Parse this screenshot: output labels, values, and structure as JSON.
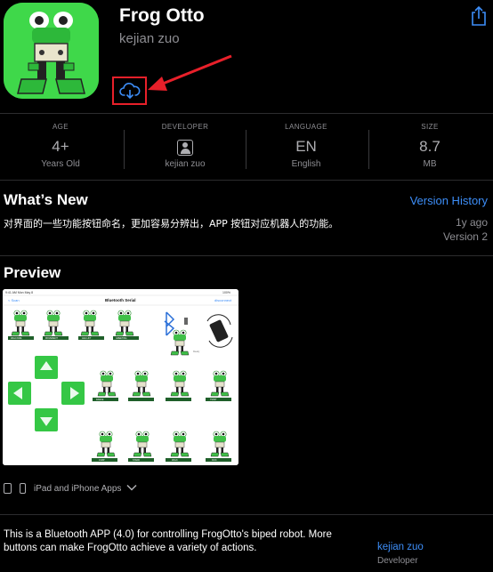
{
  "app": {
    "title": "Frog Otto",
    "developer": "kejian zuo"
  },
  "icons": {
    "share": "share-icon",
    "download": "cloud-download-icon",
    "developer": "person-square-icon"
  },
  "colors": {
    "accent": "#3d8ef8",
    "highlight": "#e8202a",
    "icon_bg": "#3fd84a"
  },
  "info": [
    {
      "caption": "AGE",
      "main": "4+",
      "sub": "Years Old"
    },
    {
      "caption": "DEVELOPER",
      "main": "",
      "sub": "kejian zuo"
    },
    {
      "caption": "LANGUAGE",
      "main": "EN",
      "sub": "English"
    },
    {
      "caption": "SIZE",
      "main": "8.7",
      "sub": "MB"
    }
  ],
  "whats_new": {
    "title": "What’s New",
    "version_history": "Version History",
    "text": "对界面的一些功能按钮命名，更加容易分辨出，APP 按钮对应机器人的功能。",
    "age": "1y ago",
    "version": "Version 2"
  },
  "preview": {
    "title": "Preview",
    "shot": {
      "status_left": "9:41 AM  Mon May 8",
      "status_right": "100%",
      "header_title": "Bluetooth Serial",
      "back": "< Scan",
      "disconnect": "disconnect",
      "frog_labels_top": [
        "WELCOME",
        "MOVEMENT",
        "LEG LIFT",
        "GREETING"
      ],
      "frog_labels_mid": [
        "DANCE",
        "",
        "",
        "TWIST"
      ],
      "frog_labels_bottom": [
        "JUMP",
        "STAND",
        "WALK",
        "KICK"
      ],
      "small_label": "Ready"
    }
  },
  "devices": {
    "label": "iPad and iPhone Apps"
  },
  "description": {
    "text": "This is a Bluetooth APP (4.0) for controlling FrogOtto's biped robot. More buttons can make FrogOtto achieve a variety of actions.",
    "developer_link": "kejian zuo",
    "developer_role": "Developer"
  }
}
